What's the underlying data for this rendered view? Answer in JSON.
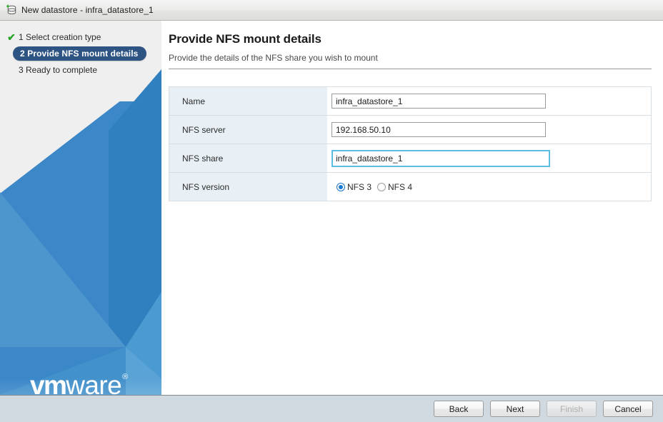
{
  "window": {
    "title": "New datastore - infra_datastore_1",
    "icon": "new-datastore-icon"
  },
  "sidebar": {
    "steps": [
      {
        "number": "1",
        "label": "1 Select creation type",
        "state": "completed",
        "check": "✔"
      },
      {
        "number": "2",
        "label": "2 Provide NFS mount details",
        "state": "active",
        "check": ""
      },
      {
        "number": "3",
        "label": "3 Ready to complete",
        "state": "pending",
        "check": ""
      }
    ],
    "logo": {
      "bold": "vm",
      "light": "ware",
      "registered": "®"
    }
  },
  "main": {
    "title": "Provide NFS mount details",
    "subtitle": "Provide the details of the NFS share you wish to mount",
    "fields": [
      {
        "label": "Name",
        "type": "text",
        "value": "infra_datastore_1",
        "placeholder": "",
        "focused": false
      },
      {
        "label": "NFS server",
        "type": "text",
        "value": "192.168.50.10",
        "placeholder": "",
        "focused": false
      },
      {
        "label": "NFS share",
        "type": "text",
        "value": "infra_datastore_1",
        "placeholder": "",
        "focused": true
      },
      {
        "label": "NFS version",
        "type": "radio",
        "options": [
          {
            "label": "NFS 3",
            "selected": true
          },
          {
            "label": "NFS 4",
            "selected": false
          }
        ]
      }
    ]
  },
  "footer": {
    "buttons": [
      {
        "label": "Back",
        "enabled": true
      },
      {
        "label": "Next",
        "enabled": true
      },
      {
        "label": "Finish",
        "enabled": false
      },
      {
        "label": "Cancel",
        "enabled": true
      }
    ]
  },
  "colors": {
    "accent_blue": "#3b87c8",
    "step_active": "#2d5483",
    "focus_border": "#5bbce4",
    "radio_selected": "#1579d0",
    "check_green": "#2aa329",
    "label_cell": "#e9f0f5",
    "footer_bg": "#d0d8e0"
  }
}
